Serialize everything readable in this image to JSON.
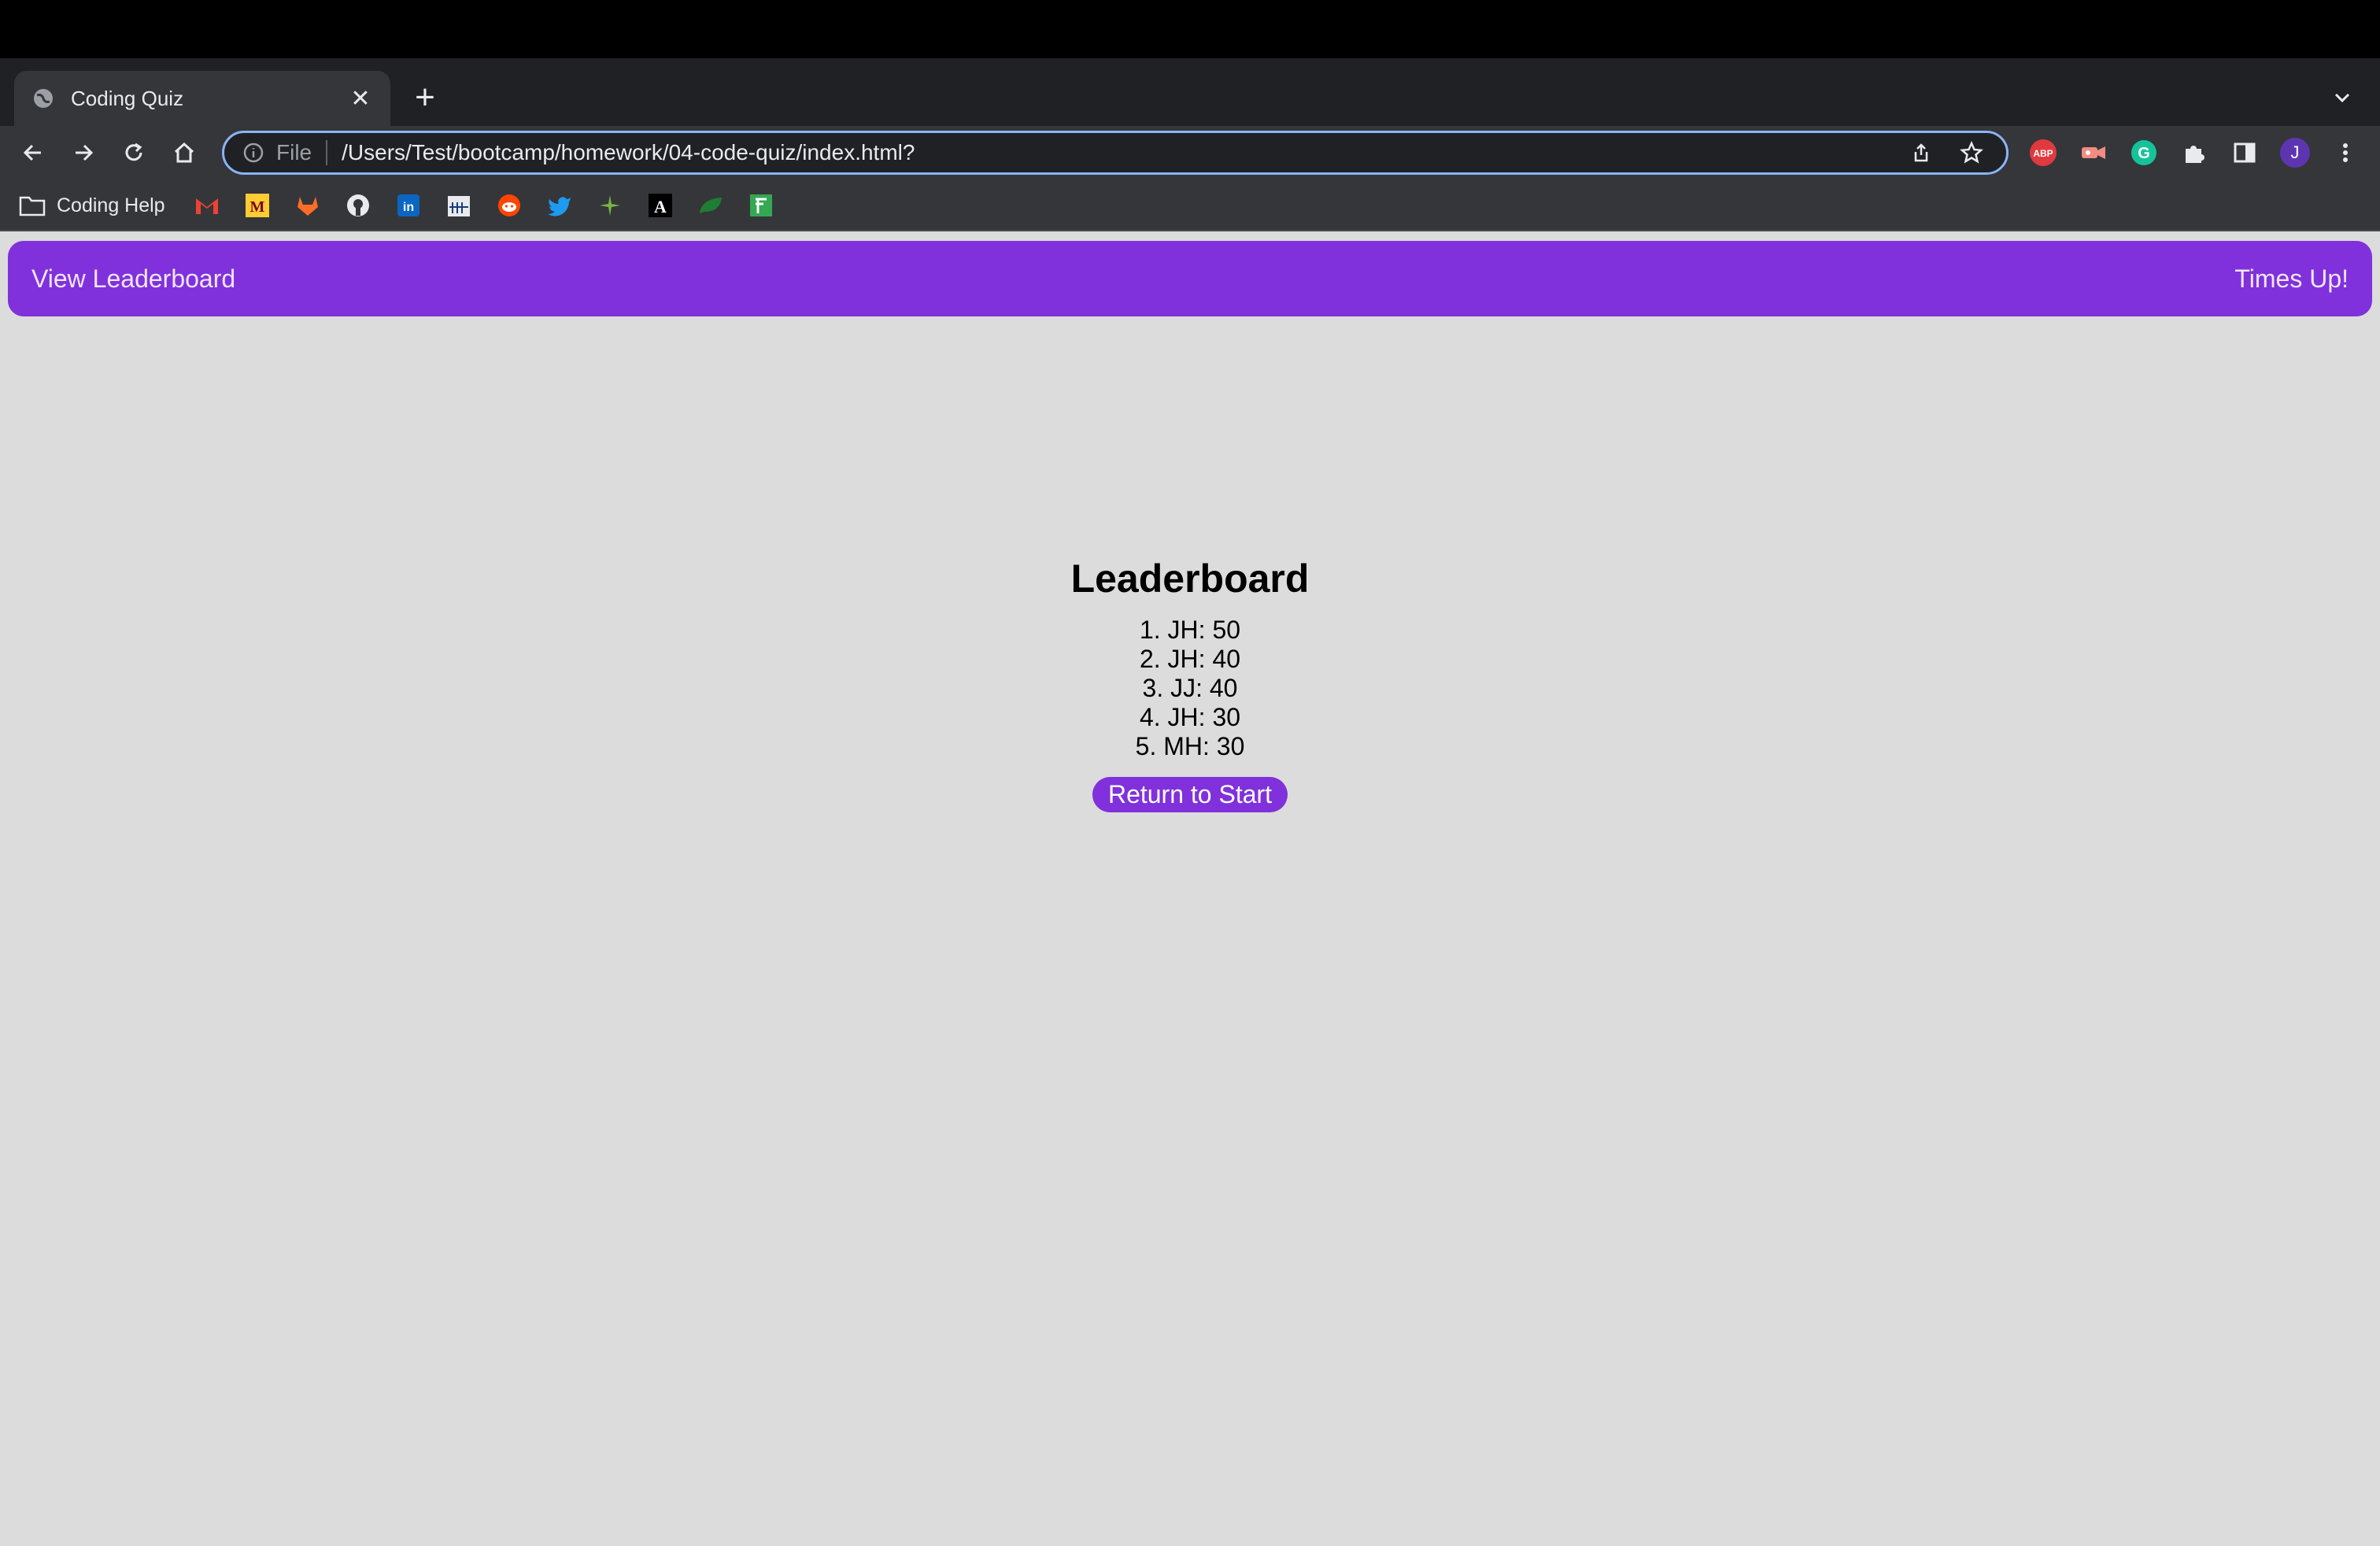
{
  "browser": {
    "tab_title": "Coding Quiz",
    "tab_close": "✕",
    "new_tab": "+",
    "omnibox_scheme": "File",
    "omnibox_url": "/Users/Test/bootcamp/homework/04-code-quiz/index.html?",
    "profile_initial": "J",
    "bookmarks_folder": "Coding Help",
    "bookmarks": [
      "gmail-icon",
      "umn-icon",
      "gitlab-icon",
      "github-icon",
      "linkedin-icon",
      "calendar-icon",
      "reddit-icon",
      "twitter-icon",
      "star-icon",
      "font-a-icon",
      "leaf-icon",
      "sheet-icon"
    ]
  },
  "header": {
    "leaderboard_link": "View Leaderboard",
    "timer": "Times Up!"
  },
  "leaderboard": {
    "title": "Leaderboard",
    "entries": [
      "1. JH: 50",
      "2. JH: 40",
      "3. JJ: 40",
      "4. JH: 30",
      "5. MH: 30"
    ],
    "return_button": "Return to Start"
  },
  "colors": {
    "accent": "#8031db",
    "page_bg": "#dcdcdc",
    "chrome_dark": "#202124",
    "chrome_toolbar": "#35363a"
  }
}
